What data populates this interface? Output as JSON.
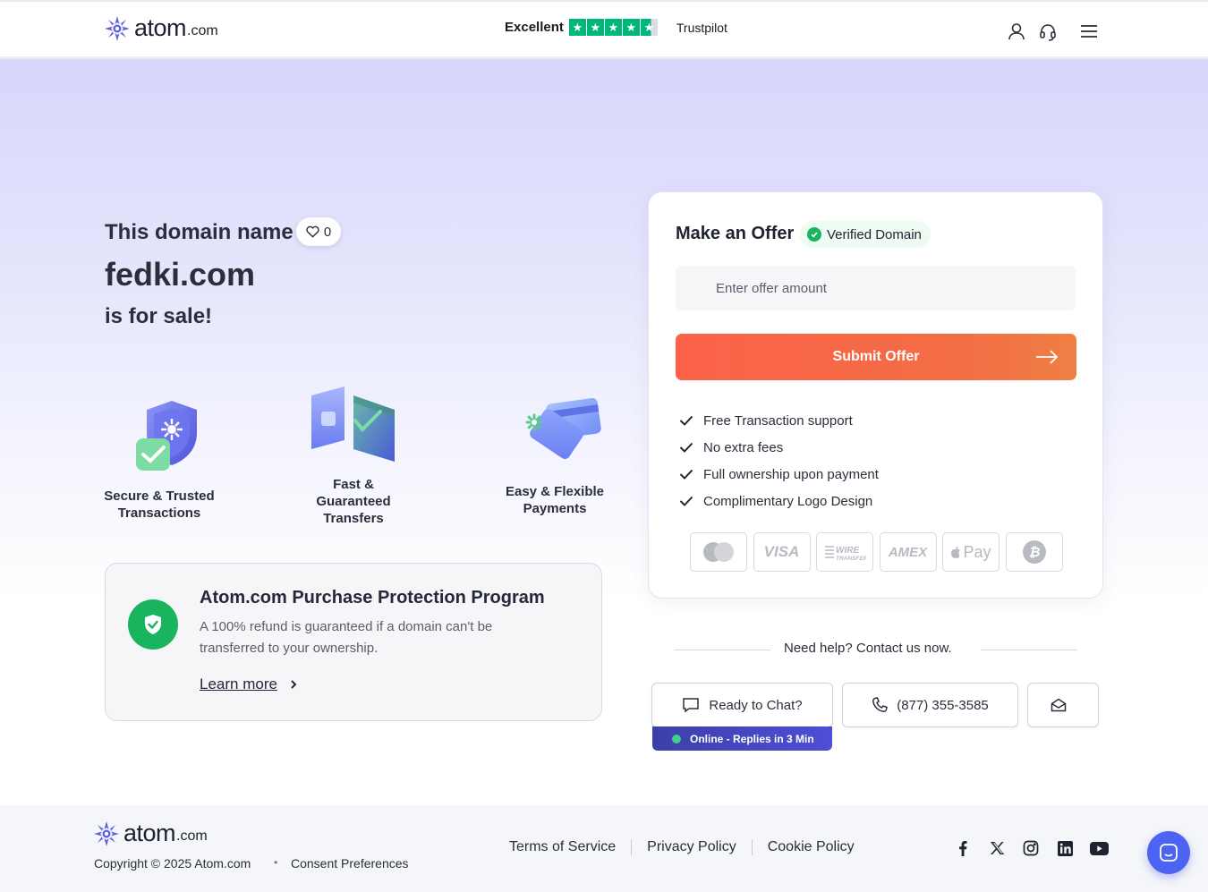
{
  "header": {
    "brand": "atom",
    "brand_tld": ".com",
    "trustpilot_rating": "Excellent",
    "trustpilot_stars": 4.5,
    "trustpilot_label": "Trustpilot"
  },
  "hero": {
    "title": "This domain name",
    "favorites_count": "0",
    "domain": "fedki.com",
    "subtitle": "is for sale!"
  },
  "features": [
    {
      "line1": "Secure & Trusted",
      "line2": "Transactions"
    },
    {
      "line1": "Fast &",
      "line2": "Guaranteed",
      "line3": "Transfers"
    },
    {
      "line1": "Easy & Flexible",
      "line2": "Payments"
    }
  ],
  "protection": {
    "title": "Atom.com Purchase Protection Program",
    "description": "A 100% refund is guaranteed if a domain can't be transferred to your ownership.",
    "link": "Learn more"
  },
  "offer": {
    "title": "Make an Offer",
    "verified": "Verified Domain",
    "currency": "$",
    "placeholder": "Enter offer amount",
    "submit": "Submit Offer",
    "benefits": [
      "Free Transaction support",
      "No extra fees",
      "Full ownership upon payment",
      "Complimentary Logo Design"
    ],
    "payment_methods": [
      "VISA",
      "AMEX",
      "Pay"
    ]
  },
  "help": {
    "text": "Need help? Contact us now.",
    "chat": "Ready to Chat?",
    "phone": "(877) 355-3585",
    "online": "Online - Replies in 3 Min"
  },
  "footer": {
    "brand": "atom",
    "brand_tld": ".com",
    "copyright": "Copyright © 2025 Atom.com",
    "bullet": "•",
    "consent": "Consent Preferences",
    "links": [
      "Terms of Service",
      "Privacy Policy",
      "Cookie Policy"
    ]
  },
  "colors": {
    "accent_orange": "#fb6248",
    "brand_purple": "#5b5fe0",
    "success_green": "#1ab35e",
    "trustpilot_green": "#00b67a"
  }
}
